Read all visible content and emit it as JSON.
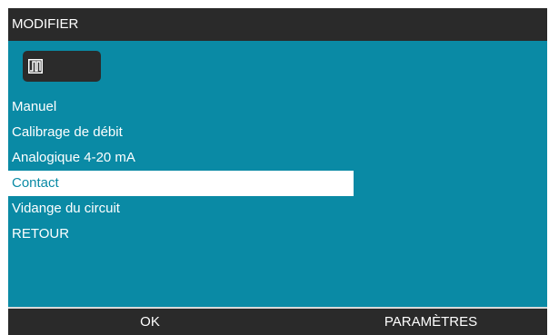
{
  "header": {
    "title": "MODIFIER"
  },
  "mode": {
    "icon": "pulse-contact-icon"
  },
  "menu": {
    "items": [
      {
        "label": "Manuel"
      },
      {
        "label": "Calibrage de débit"
      },
      {
        "label": "Analogique 4-20 mA"
      },
      {
        "label": "Contact",
        "selected": true
      },
      {
        "label": "Vidange du circuit"
      },
      {
        "label": "RETOUR"
      }
    ]
  },
  "softkeys": {
    "left": "OK",
    "right": "PARAMÈTRES"
  },
  "colors": {
    "screen": "#0a8aa5",
    "bars": "#2a2a2a",
    "highlight": "#ffffff"
  }
}
